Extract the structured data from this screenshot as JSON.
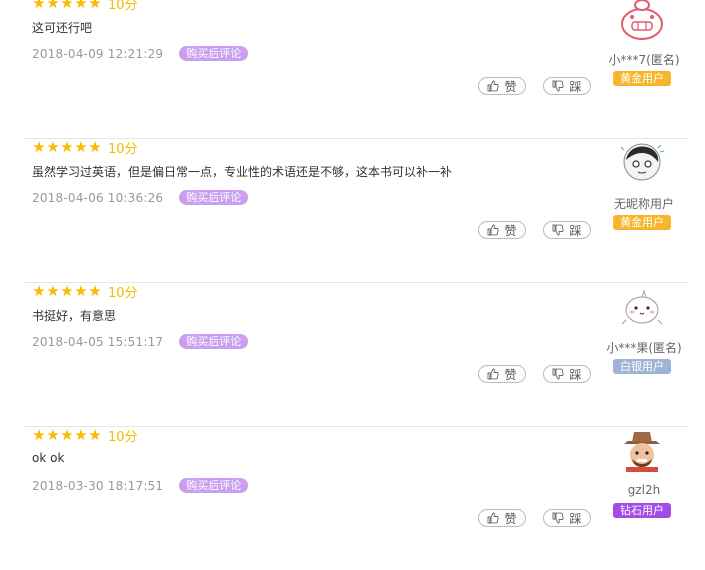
{
  "reviews": [
    {
      "score": "10分",
      "content": "这可还行吧",
      "timestamp": "2018-04-09 12:21:29",
      "badge": "购买后评论",
      "like_label": "赞",
      "dislike_label": "踩",
      "username": "小***7(匿名)",
      "level": "黄金用户",
      "level_color": "#f7b52c",
      "stars": 5
    },
    {
      "score": "10分",
      "content": "虽然学习过英语，但是偏日常一点，专业性的术语还是不够，这本书可以补一补",
      "timestamp": "2018-04-06 10:36:26",
      "badge": "购买后评论",
      "like_label": "赞",
      "dislike_label": "踩",
      "username": "无昵称用户",
      "level": "黄金用户",
      "level_color": "#f7b52c",
      "stars": 5
    },
    {
      "score": "10分",
      "content": "书挺好，有意思",
      "timestamp": "2018-04-05 15:51:17",
      "badge": "购买后评论",
      "like_label": "赞",
      "dislike_label": "踩",
      "username": "小***果(匿名)",
      "level": "白银用户",
      "level_color": "#9fb4d4",
      "stars": 5
    },
    {
      "score": "10分",
      "content": "ok ok",
      "timestamp": "2018-03-30 18:17:51",
      "badge": "购买后评论",
      "like_label": "赞",
      "dislike_label": "踩",
      "username": "gzl2h",
      "level": "钻石用户",
      "level_color": "#a44ce6",
      "stars": 5
    }
  ]
}
